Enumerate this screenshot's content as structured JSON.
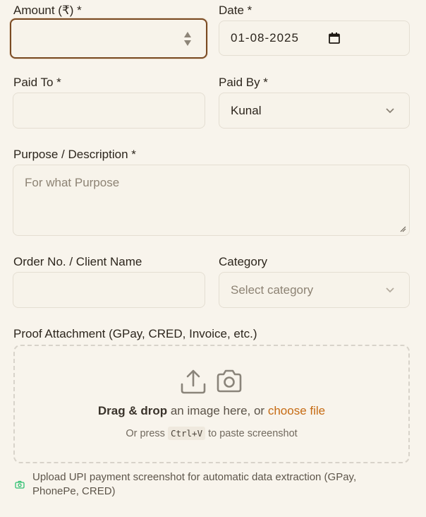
{
  "amount": {
    "label": "Amount (₹) *",
    "value": ""
  },
  "date": {
    "label": "Date *",
    "value": "01-08-2025"
  },
  "paid_to": {
    "label": "Paid To *",
    "value": ""
  },
  "paid_by": {
    "label": "Paid By *",
    "value": "Kunal"
  },
  "purpose": {
    "label": "Purpose / Description *",
    "placeholder": "For what Purpose"
  },
  "order": {
    "label": "Order No. / Client Name",
    "value": ""
  },
  "category": {
    "label": "Category",
    "placeholder": "Select category"
  },
  "proof": {
    "label": "Proof Attachment (GPay, CRED, Invoice, etc.)",
    "drag_bold": "Drag & drop",
    "drag_text": " an image here, or ",
    "choose_file": "choose file",
    "paste_prefix": "Or press ",
    "paste_key": "Ctrl+V",
    "paste_suffix": " to paste screenshot",
    "icons": [
      "upload-icon",
      "camera-icon"
    ]
  },
  "hint": "Upload UPI payment screenshot for automatic data extraction (GPay, PhonePe, CRED)",
  "colors": {
    "background": "#f8f4ec",
    "focus_border": "#7a4a22",
    "link": "#c66b13",
    "hint_icon": "#2fbf71"
  }
}
